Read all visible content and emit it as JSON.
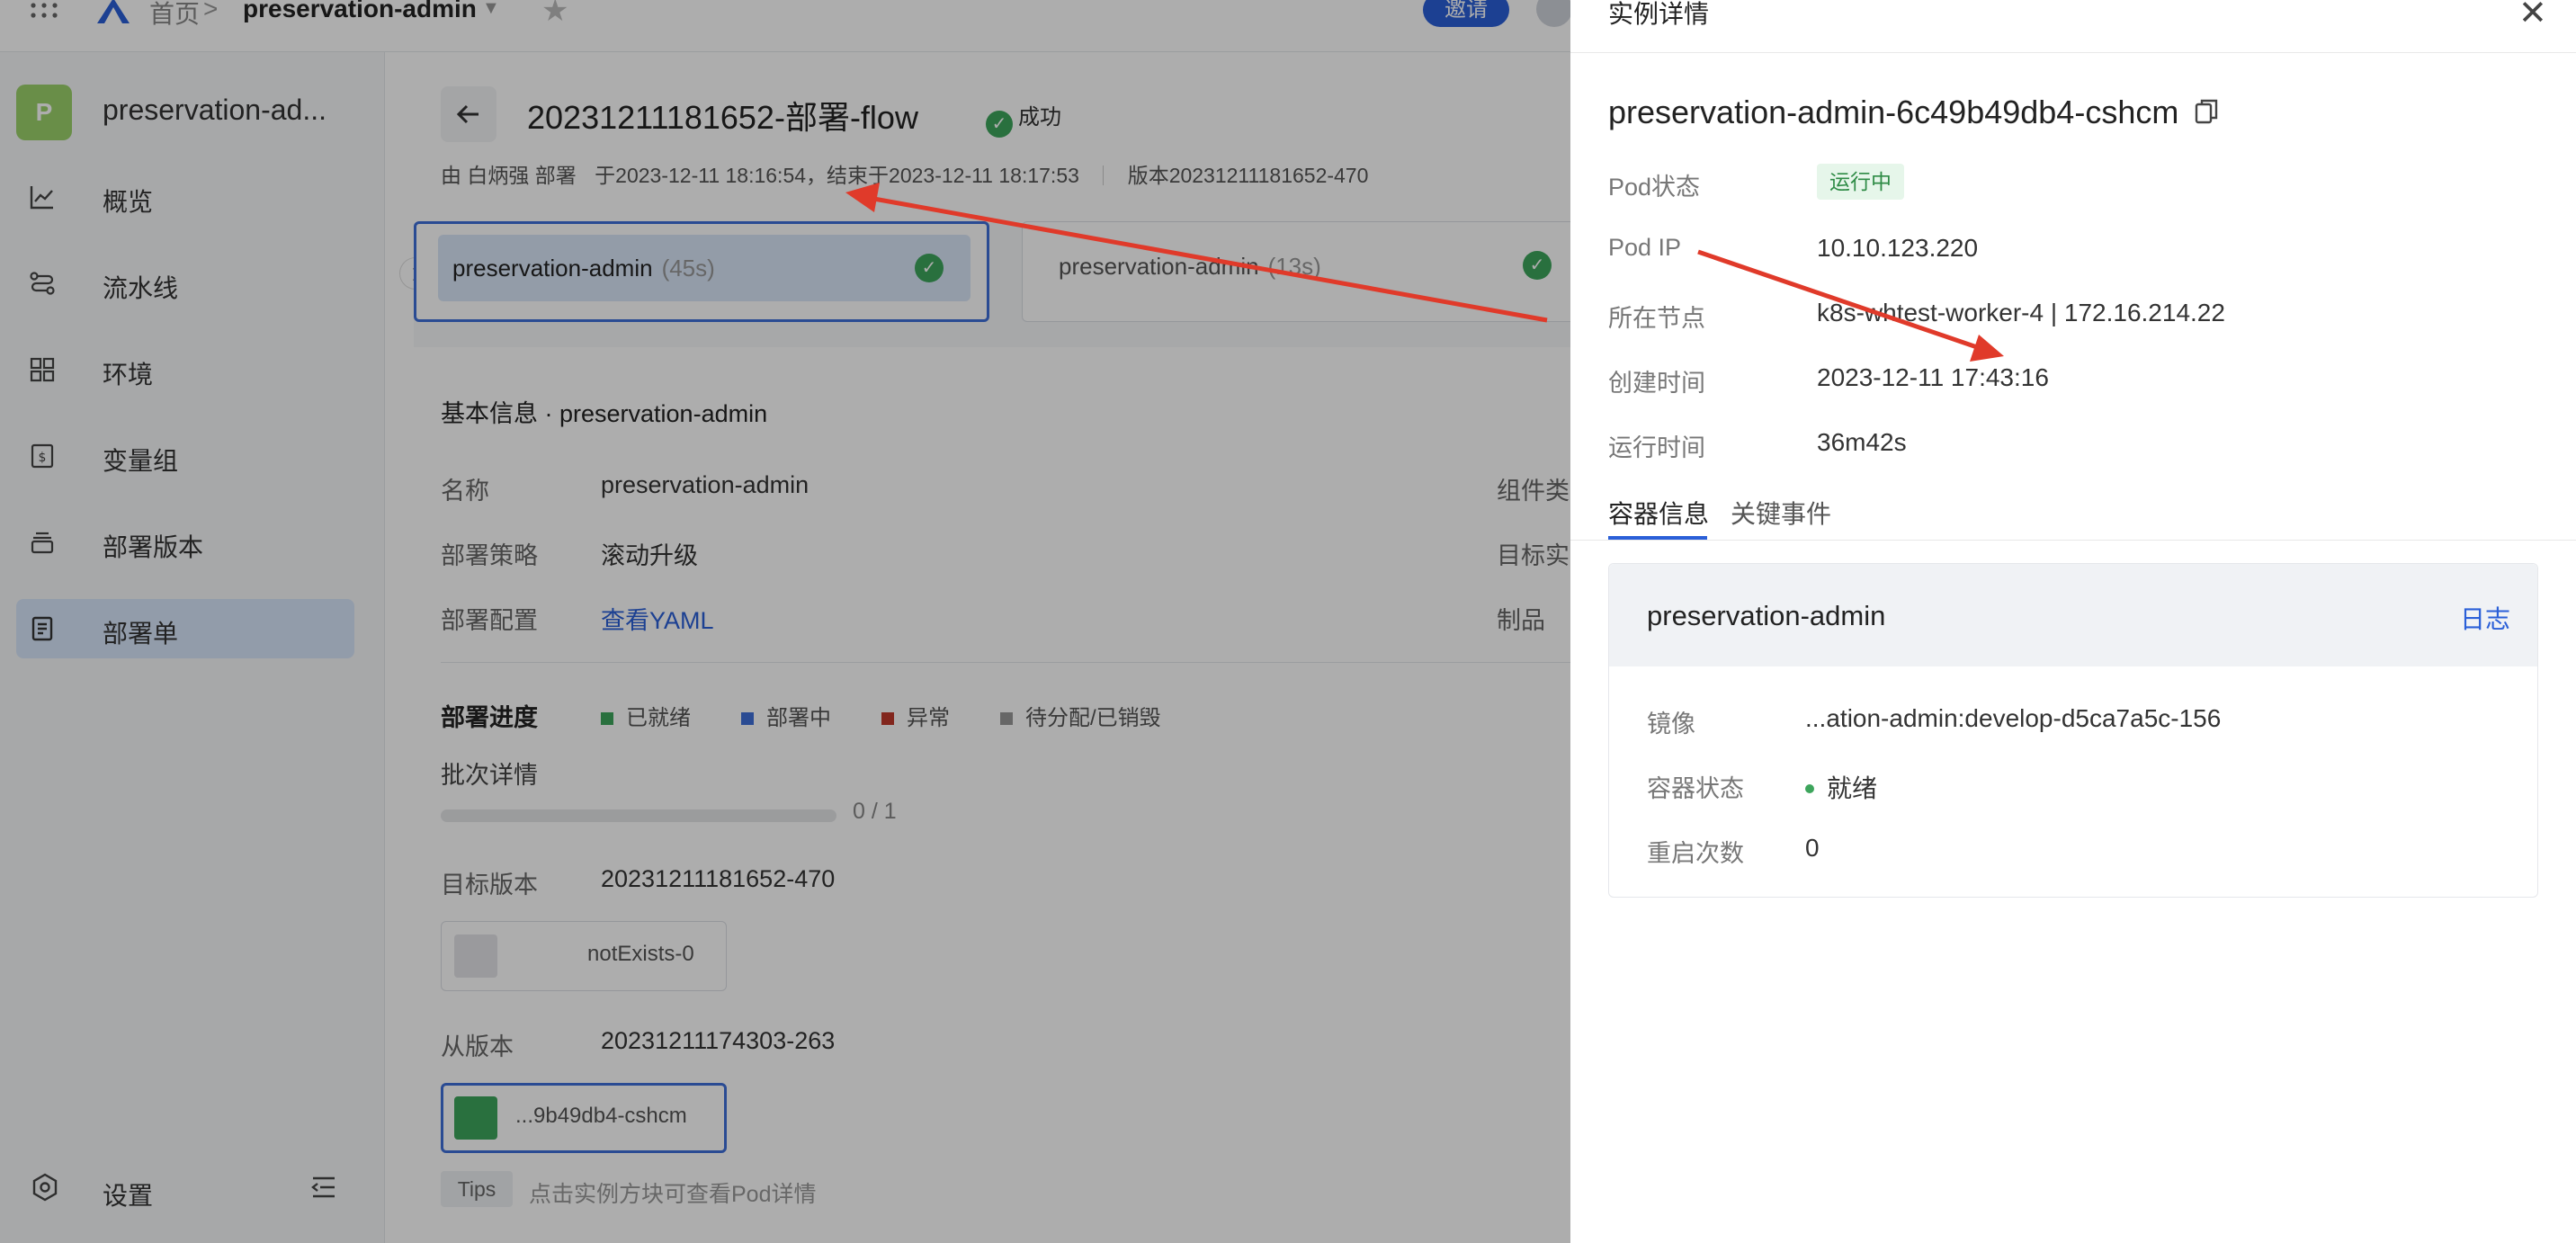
{
  "topbar": {
    "home": "首页",
    "separator": ">",
    "app_name": "preservation-admin",
    "invite_label": "邀请"
  },
  "sidebar": {
    "app_badge": "P",
    "app_title": "preservation-ad...",
    "items": [
      {
        "label": "概览",
        "icon": "chart-line-icon"
      },
      {
        "label": "流水线",
        "icon": "pipeline-icon"
      },
      {
        "label": "环境",
        "icon": "grid-icon"
      },
      {
        "label": "变量组",
        "icon": "dollar-box-icon"
      },
      {
        "label": "部署版本",
        "icon": "stack-icon"
      },
      {
        "label": "部署单",
        "icon": "document-icon",
        "active": true
      }
    ],
    "settings_label": "设置"
  },
  "main": {
    "title": "20231211181652-部署-flow",
    "status": "成功",
    "meta_deployer": "由 白炳强 部署",
    "meta_time": "于2023-12-11 18:16:54，结束于2023-12-11 18:17:53",
    "meta_version": "版本20231211181652-470",
    "stages": [
      {
        "name": "preservation-admin",
        "duration": "(45s)",
        "selected": true
      },
      {
        "name": "preservation-admin",
        "duration": "(13s)",
        "selected": false
      }
    ],
    "basic_info_title": "基本信息 · preservation-admin",
    "fields": {
      "name_label": "名称",
      "name_value": "preservation-admin",
      "strategy_label": "部署策略",
      "strategy_value": "滚动升级",
      "config_label": "部署配置",
      "config_value": "查看YAML",
      "component_type_label": "组件类",
      "target_instance_label": "目标实",
      "artifact_label": "制品"
    },
    "progress": {
      "title": "部署进度",
      "legend": [
        {
          "label": "已就绪",
          "color": "#3da55c"
        },
        {
          "label": "部署中",
          "color": "#3e6fd9"
        },
        {
          "label": "异常",
          "color": "#c0392b"
        },
        {
          "label": "待分配/已销毁",
          "color": "#999999"
        }
      ],
      "batch_label": "批次详情",
      "batch_count": "0 / 1",
      "batch_progress": 0
    },
    "target_version_label": "目标版本",
    "target_version_value": "20231211181652-470",
    "target_pod": "notExists-0",
    "from_version_label": "从版本",
    "from_version_value": "20231211174303-263",
    "from_pod": "...9b49db4-cshcm",
    "tips_tag": "Tips",
    "tips_text": "点击实例方块可查看Pod详情"
  },
  "drawer": {
    "title": "实例详情",
    "pod_name": "preservation-admin-6c49b49db4-cshcm",
    "pod_status_label": "Pod状态",
    "pod_status_value": "运行中",
    "pod_ip_label": "Pod IP",
    "pod_ip_value": "10.10.123.220",
    "node_label": "所在节点",
    "node_value": "k8s-whtest-worker-4 | 172.16.214.22",
    "created_label": "创建时间",
    "created_value": "2023-12-11 17:43:16",
    "runtime_label": "运行时间",
    "runtime_value": "36m42s",
    "tabs": [
      "容器信息",
      "关键事件"
    ],
    "container": {
      "name": "preservation-admin",
      "log_label": "日志",
      "image_label": "镜像",
      "image_value": "...ation-admin:develop-d5ca7a5c-156",
      "status_label": "容器状态",
      "status_value": "就绪",
      "restart_label": "重启次数",
      "restart_value": "0"
    }
  },
  "colors": {
    "accent": "#2a5fd8",
    "success": "#3da55c",
    "annotation_arrow": "#e03a2a"
  }
}
